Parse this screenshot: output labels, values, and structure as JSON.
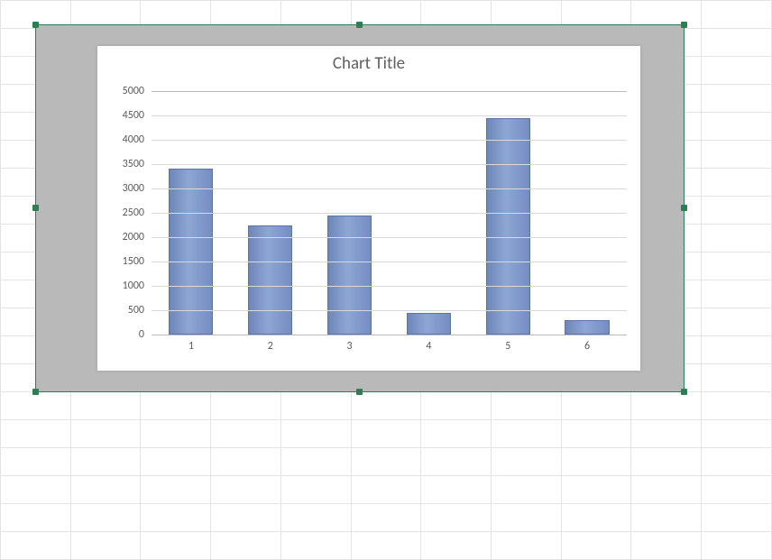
{
  "chart_data": {
    "type": "bar",
    "title": "Chart Title",
    "categories": [
      "1",
      "2",
      "3",
      "4",
      "5",
      "6"
    ],
    "values": [
      3400,
      2250,
      2450,
      450,
      4450,
      300
    ],
    "ylim": [
      0,
      5000
    ],
    "ystep": 500,
    "yticks": [
      "0",
      "500",
      "1000",
      "1500",
      "2000",
      "2500",
      "3000",
      "3500",
      "4000",
      "4500",
      "5000"
    ],
    "xlabel": "",
    "ylabel": ""
  }
}
